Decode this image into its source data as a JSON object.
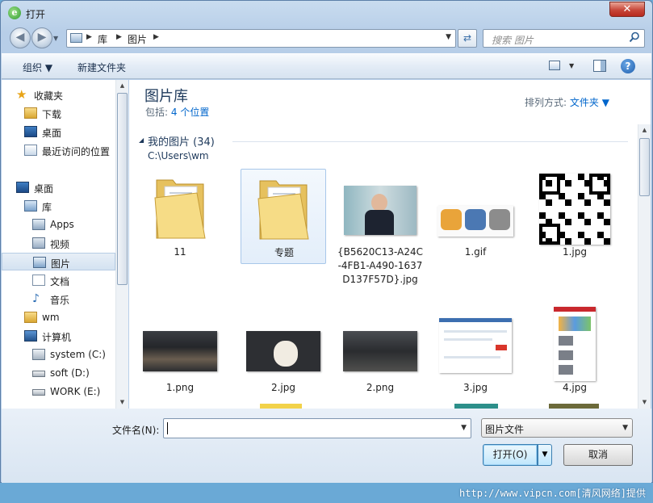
{
  "window": {
    "title": "打开",
    "close_glyph": "✕"
  },
  "nav": {
    "back_glyph": "◀",
    "forward_glyph": "▶",
    "dropdown_glyph": "▼"
  },
  "address": {
    "crumbs": [
      "库",
      "图片"
    ],
    "sep": "▶",
    "dropdown_glyph": "▼",
    "refresh_glyph": "⇄"
  },
  "search": {
    "placeholder": "搜索 图片"
  },
  "toolbar": {
    "organize": "组织 ▼",
    "new_folder": "新建文件夹",
    "view_dd": "▼",
    "help": "?"
  },
  "sidebar": {
    "items": [
      {
        "label": "收藏夹",
        "icon": "star-icon"
      },
      {
        "label": "下载",
        "icon": "download-folder-icon"
      },
      {
        "label": "桌面",
        "icon": "desktop-icon"
      },
      {
        "label": "最近访问的位置",
        "icon": "recent-places-icon"
      },
      {
        "label": "桌面",
        "icon": "desktop-icon"
      },
      {
        "label": "库",
        "icon": "library-icon"
      },
      {
        "label": "Apps",
        "icon": "apps-icon"
      },
      {
        "label": "视频",
        "icon": "video-library-icon"
      },
      {
        "label": "图片",
        "icon": "pictures-library-icon",
        "selected": true
      },
      {
        "label": "文档",
        "icon": "documents-library-icon"
      },
      {
        "label": "音乐",
        "icon": "music-library-icon"
      },
      {
        "label": "wm",
        "icon": "user-folder-icon"
      },
      {
        "label": "计算机",
        "icon": "computer-icon"
      },
      {
        "label": "system (C:)",
        "icon": "system-drive-icon"
      },
      {
        "label": "soft (D:)",
        "icon": "drive-icon"
      },
      {
        "label": "WORK (E:)",
        "icon": "drive-icon"
      }
    ]
  },
  "library": {
    "title": "图片库",
    "includes_label": "包括:",
    "includes_link": "4 个位置",
    "sort_label": "排列方式:",
    "sort_value": "文件夹 ▼"
  },
  "group": {
    "arrow": "◢",
    "title": "我的图片 (34)",
    "path": "C:\\Users\\wm"
  },
  "files": [
    {
      "name": "11",
      "kind": "folder"
    },
    {
      "name": "专题",
      "kind": "folder",
      "selected": true
    },
    {
      "name": "{B5620C13-A24C-4FB1-A490-1637D137F57D}.jpg",
      "kind": "photo-man"
    },
    {
      "name": "1.gif",
      "kind": "app-icons"
    },
    {
      "name": "1.jpg",
      "kind": "qr-code"
    },
    {
      "name": "1.png",
      "kind": "dark-web"
    },
    {
      "name": "2.jpg",
      "kind": "dog"
    },
    {
      "name": "2.png",
      "kind": "dark-scene"
    },
    {
      "name": "3.jpg",
      "kind": "web-form"
    },
    {
      "name": "4.jpg",
      "kind": "phone-page"
    }
  ],
  "bottom": {
    "filename_label": "文件名(N):",
    "filename_value": "",
    "dropdown_glyph": "▼",
    "filetype_value": "图片文件",
    "open_button": "打开(O)",
    "open_split_glyph": "▼",
    "cancel_button": "取消"
  },
  "watermark": "http://www.vipcn.com[清风网络]提供"
}
